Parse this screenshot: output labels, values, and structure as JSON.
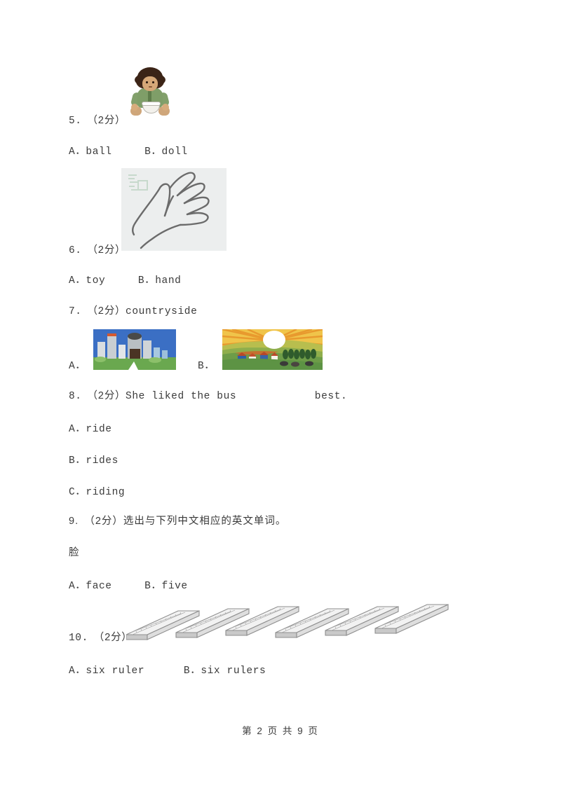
{
  "document": {
    "footer": "第 2 页 共 9 页",
    "page_number": "2",
    "total_pages": "9"
  },
  "questions": [
    {
      "number": "5.",
      "score": "（2分）",
      "stem": "",
      "prompt_line": "5.　（2分）",
      "options_line": "A．ball     B．doll",
      "options": [
        "A．ball",
        "B．doll"
      ],
      "image": "doll-illustration"
    },
    {
      "number": "6.",
      "score": "（2分）",
      "stem": "",
      "prompt_line": "6.　（2分）",
      "options_line": "A．toy     B．hand",
      "options": [
        "A．toy",
        "B．hand"
      ],
      "image": "hand-drawing"
    },
    {
      "number": "7.",
      "score": "（2分）",
      "stem": "countryside",
      "prompt_line": "7.　（2分）countryside",
      "option_a_label": "A．",
      "option_b_label": "B．",
      "image_a": "city-skyline-illustration",
      "image_b": "countryside-sunset-illustration"
    },
    {
      "number": "8.",
      "score": "（2分）",
      "stem": "She liked the bus            best.",
      "prompt_line": "8.　（2分）She liked the bus            best.",
      "options": [
        "A．ride",
        "B．rides",
        "C．riding"
      ]
    },
    {
      "number": "9.",
      "score": "（2分）",
      "stem": "选出与下列中文相应的英文单词。",
      "prompt_line": "9.　（2分）选出与下列中文相应的英文单词。",
      "chinese_word": "脸",
      "options_line": "A．face     B．five",
      "options": [
        "A．face",
        "B．five"
      ]
    },
    {
      "number": "10.",
      "score": "（2分）",
      "stem": "",
      "prompt_line": "10.　（2分）",
      "options_line": "A．six ruler      B．six rulers",
      "options": [
        "A．six ruler",
        "B．six rulers"
      ],
      "image": "six-rulers-illustration",
      "ruler_count": 6
    }
  ],
  "colors": {
    "text": "#3a3a3a",
    "page_background": "#ffffff",
    "city_sky": "#3b6fc4",
    "city_ground": "#6aa84f",
    "country_sky": "#e8a33d",
    "country_field": "#79a84a",
    "doll_jacket": "#7f9e68",
    "doll_hair": "#3b2417",
    "ruler_body": "#e8e8e8"
  }
}
